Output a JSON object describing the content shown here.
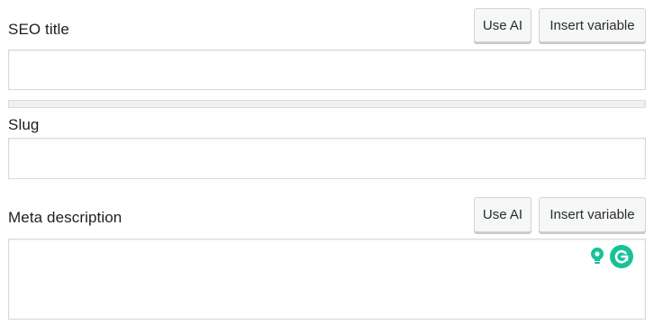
{
  "seo_title": {
    "label": "SEO title",
    "value": "",
    "use_ai_label": "Use AI",
    "insert_variable_label": "Insert variable",
    "length_progress_fraction": 0
  },
  "slug": {
    "label": "Slug",
    "value": ""
  },
  "meta_description": {
    "label": "Meta description",
    "value": "",
    "use_ai_label": "Use AI",
    "insert_variable_label": "Insert variable"
  },
  "grammarly": {
    "suggestion_icon": "lightbulb-icon",
    "logo_icon": "grammarly-g-icon",
    "brand_color": "#15c39a"
  },
  "colors": {
    "progress_empty": "#f0f0f1",
    "button_bg": "#f6f7f7"
  }
}
